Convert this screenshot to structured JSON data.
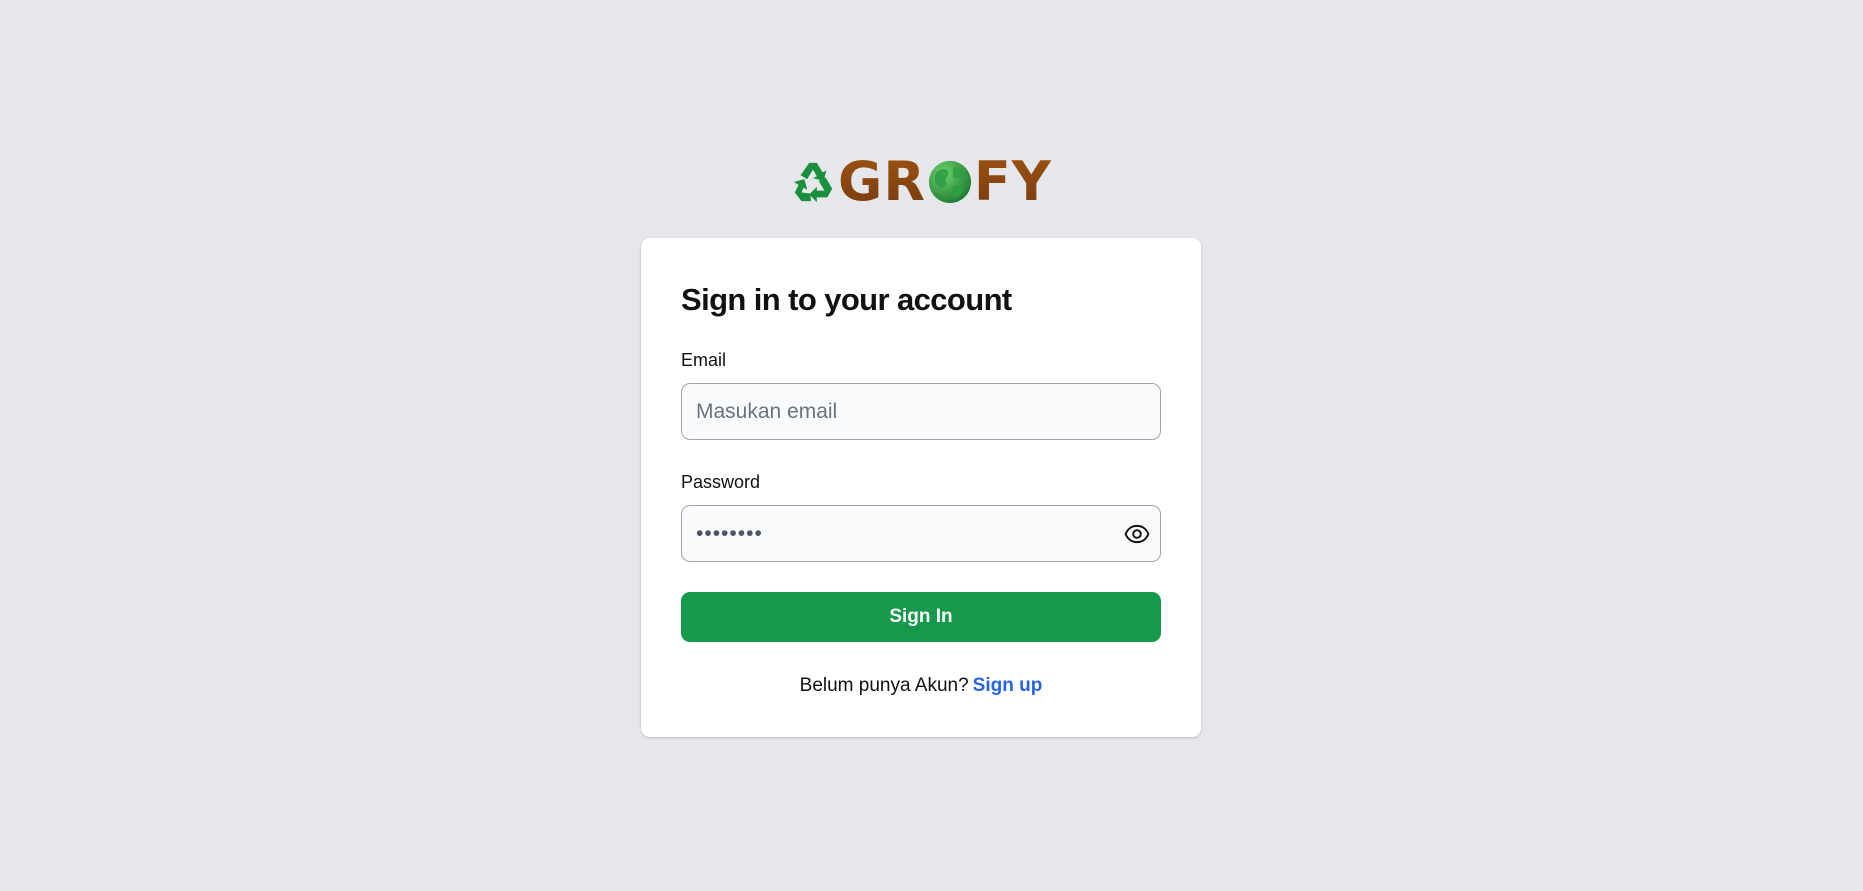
{
  "brand": {
    "logo_text": "GROFY",
    "logo_text_left": "GR",
    "logo_text_right": "FY",
    "accent_color": "#16994a",
    "logo_color": "#8b4513",
    "link_color": "#2563eb"
  },
  "signin": {
    "title": "Sign in to your account",
    "email_label": "Email",
    "email_placeholder": "Masukan email",
    "email_value": "",
    "password_label": "Password",
    "password_value": "••••••••",
    "password_toggle_icon": "eye-icon",
    "submit_label": "Sign In",
    "footer_prompt": "Belum punya Akun?",
    "footer_link": "Sign up"
  }
}
